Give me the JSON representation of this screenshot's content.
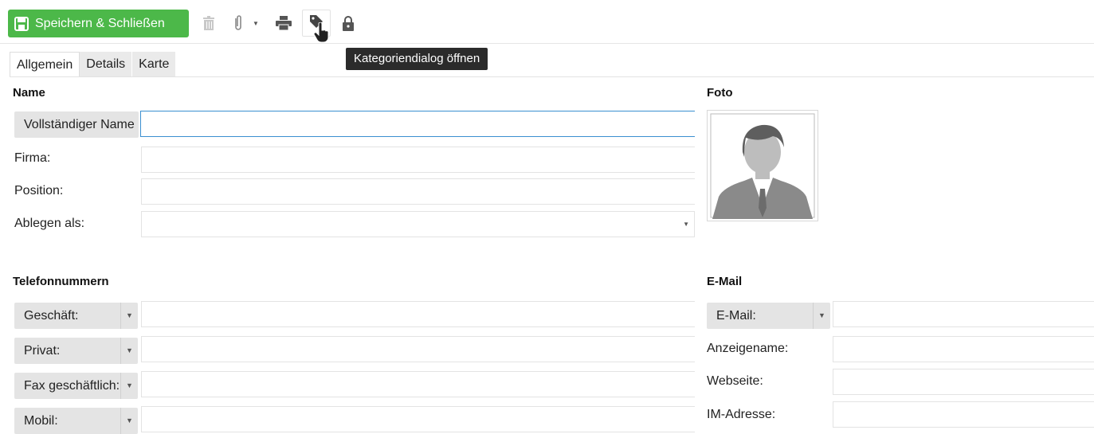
{
  "toolbar": {
    "save_label": "Speichern & Schließen",
    "icons": [
      "save-icon",
      "delete-icon",
      "attachment-icon",
      "print-icon",
      "tag-icon",
      "lock-icon"
    ],
    "tooltip": "Kategoriendialog öffnen",
    "accent_color": "#4cb849"
  },
  "tabs": [
    "Allgemein",
    "Details",
    "Karte"
  ],
  "name_section": {
    "title": "Name",
    "full_name_btn": "Vollständiger Name",
    "firma_label": "Firma:",
    "position_label": "Position:",
    "ablegen_label": "Ablegen als:"
  },
  "photo_section": {
    "title": "Foto"
  },
  "phone_section": {
    "title": "Telefonnummern",
    "items": [
      "Geschäft:",
      "Privat:",
      "Fax geschäftlich:",
      "Mobil:"
    ]
  },
  "email_section": {
    "title": "E-Mail",
    "email_btn": "E-Mail:",
    "anzeigename_label": "Anzeigename:",
    "webseite_label": "Webseite:",
    "im_label": "IM-Adresse:"
  }
}
